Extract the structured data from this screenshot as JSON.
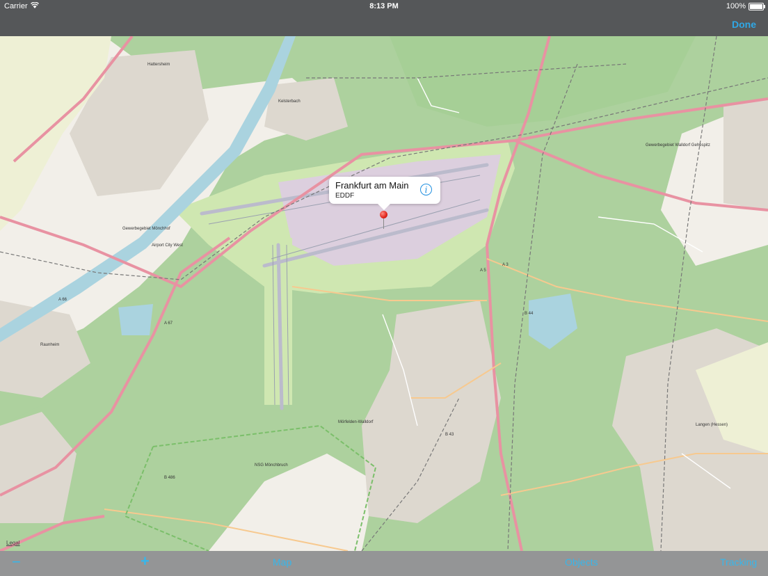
{
  "status_bar": {
    "carrier": "Carrier",
    "time": "8:13 PM",
    "battery": "100%"
  },
  "nav_bar": {
    "done_label": "Done"
  },
  "map": {
    "legal_label": "Legal",
    "place_labels": [
      "Hattersheim",
      "Kelsterbach",
      "Raunheim",
      "Mörfelden-Walldorf",
      "Langen (Hessen)",
      "NSG Mönchbruch",
      "Airport City West",
      "Gewerbegebiet Mönchhof",
      "Gewerbegebiet Walldorf Gehespitz"
    ],
    "road_labels": [
      "A 3",
      "A 5",
      "A 67",
      "A 66",
      "B 486",
      "B 44",
      "B 43"
    ]
  },
  "callout": {
    "title": "Frankfurt am Main",
    "subtitle": "EDDF"
  },
  "toolbar": {
    "zoom_out_label": "−",
    "zoom_in_label": "+",
    "map_label": "Map",
    "objects_label": "Objects",
    "tracking_label": "Tracking"
  },
  "colors": {
    "bars": "#555759",
    "toolbar": "#949596",
    "accent": "#2fa8e6",
    "forest": "#add19e",
    "motorway": "#e892a2",
    "water": "#aad3df"
  }
}
